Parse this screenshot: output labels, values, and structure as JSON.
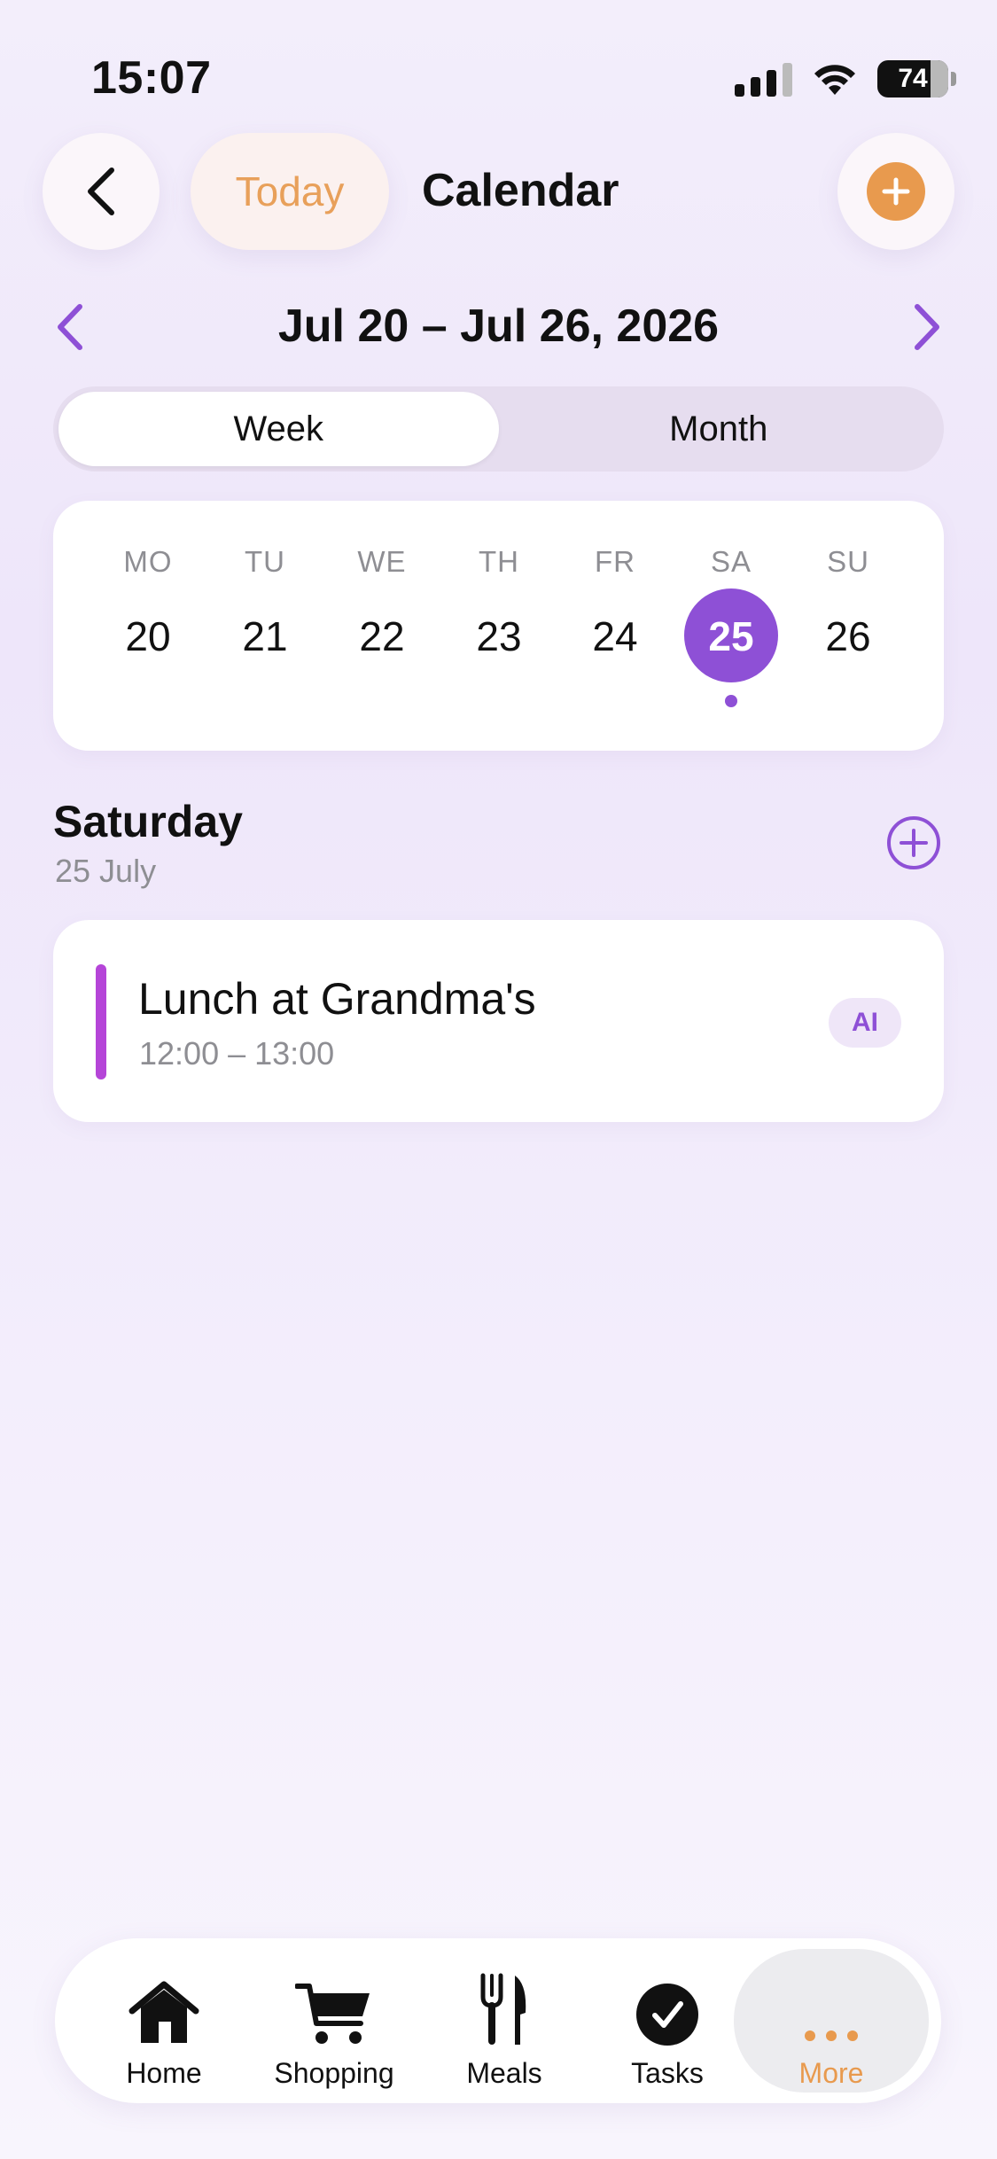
{
  "status_bar": {
    "time": "15:07",
    "battery": "74"
  },
  "header": {
    "today_label": "Today",
    "title": "Calendar"
  },
  "range": {
    "label": "Jul 20 – Jul 26, 2026"
  },
  "view_toggle": {
    "week": "Week",
    "month": "Month",
    "selected": "Week"
  },
  "week": {
    "days": [
      {
        "abbr": "MO",
        "num": "20"
      },
      {
        "abbr": "TU",
        "num": "21"
      },
      {
        "abbr": "WE",
        "num": "22"
      },
      {
        "abbr": "TH",
        "num": "23"
      },
      {
        "abbr": "FR",
        "num": "24"
      },
      {
        "abbr": "SA",
        "num": "25"
      },
      {
        "abbr": "SU",
        "num": "26"
      }
    ],
    "selected_num": "25"
  },
  "day": {
    "weekday": "Saturday",
    "date": "25 July"
  },
  "events": [
    {
      "title": "Lunch at Grandma's",
      "time": "12:00 – 13:00",
      "badge": "AI",
      "color": "#b545d8"
    }
  ],
  "tabs": [
    {
      "label": "Home",
      "icon": "house-icon"
    },
    {
      "label": "Shopping",
      "icon": "cart-icon"
    },
    {
      "label": "Meals",
      "icon": "fork-knife-icon"
    },
    {
      "label": "Tasks",
      "icon": "check-circle-icon"
    },
    {
      "label": "More",
      "icon": "ellipsis-icon",
      "active": true
    }
  ],
  "colors": {
    "accent_purple": "#8e50d6",
    "accent_orange": "#e89a4e"
  }
}
